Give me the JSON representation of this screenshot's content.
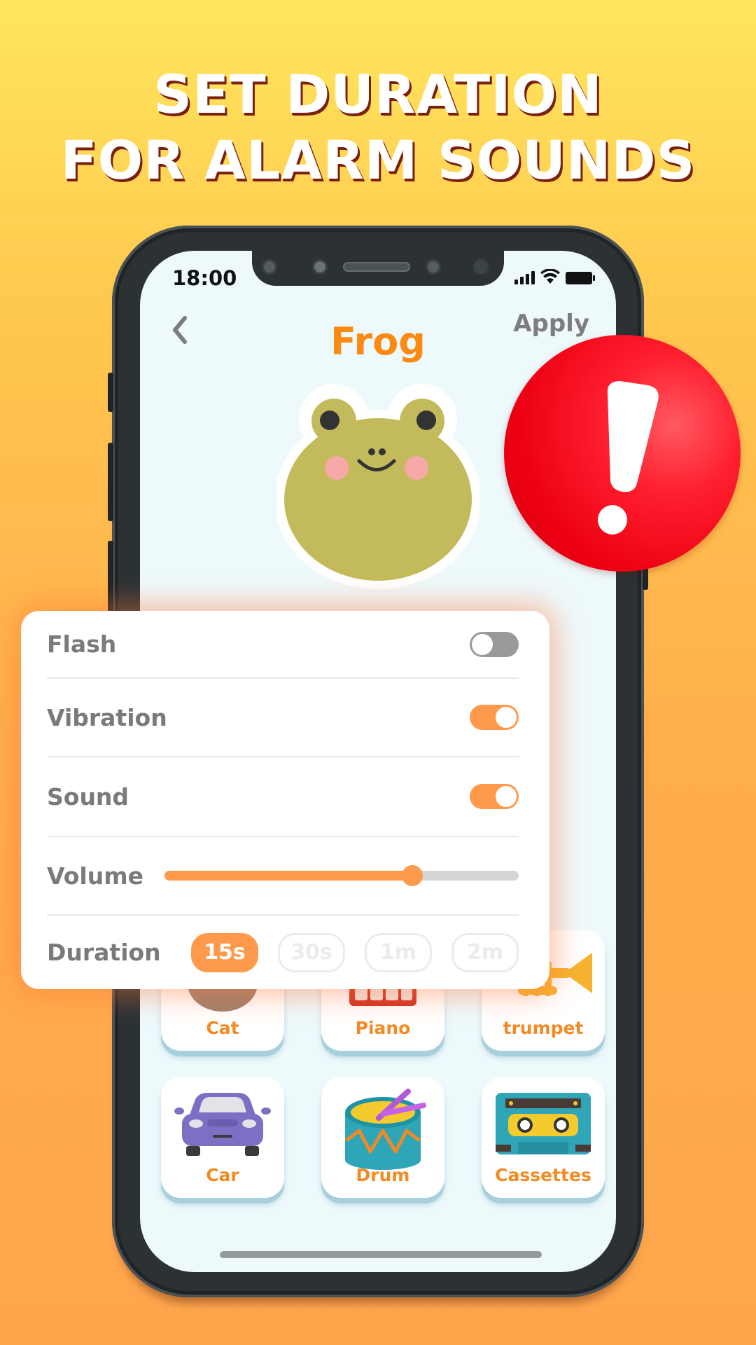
{
  "headline": {
    "line1": "SET DURATION",
    "line2": "FOR ALARM SOUNDS"
  },
  "status_bar": {
    "time": "18:00",
    "icons": [
      "signal-icon",
      "wifi-icon",
      "battery-icon"
    ]
  },
  "header": {
    "back_icon": "chevron-left-icon",
    "title": "Frog",
    "apply_label": "Apply"
  },
  "alert_badge": {
    "icon": "exclamation-icon",
    "color": "#ec0011"
  },
  "settings": {
    "flash": {
      "label": "Flash",
      "enabled": false
    },
    "vibration": {
      "label": "Vibration",
      "enabled": true
    },
    "sound": {
      "label": "Sound",
      "enabled": true
    },
    "volume": {
      "label": "Volume",
      "value_fraction": 0.7
    },
    "duration": {
      "label": "Duration",
      "options": [
        "15s",
        "30s",
        "1m",
        "2m"
      ],
      "selected": "15s"
    }
  },
  "sounds": [
    {
      "label": "Cat",
      "icon": "cat-icon"
    },
    {
      "label": "Piano",
      "icon": "piano-icon"
    },
    {
      "label": "trumpet",
      "icon": "trumpet-icon"
    },
    {
      "label": "Car",
      "icon": "car-icon"
    },
    {
      "label": "Drum",
      "icon": "drum-icon"
    },
    {
      "label": "Cassettes",
      "icon": "cassette-icon"
    }
  ],
  "colors": {
    "accent": "#ff9a4c",
    "title_orange": "#fb8a15",
    "label_gray": "#7a7a7a",
    "screen_bg": "#eef9fc"
  }
}
